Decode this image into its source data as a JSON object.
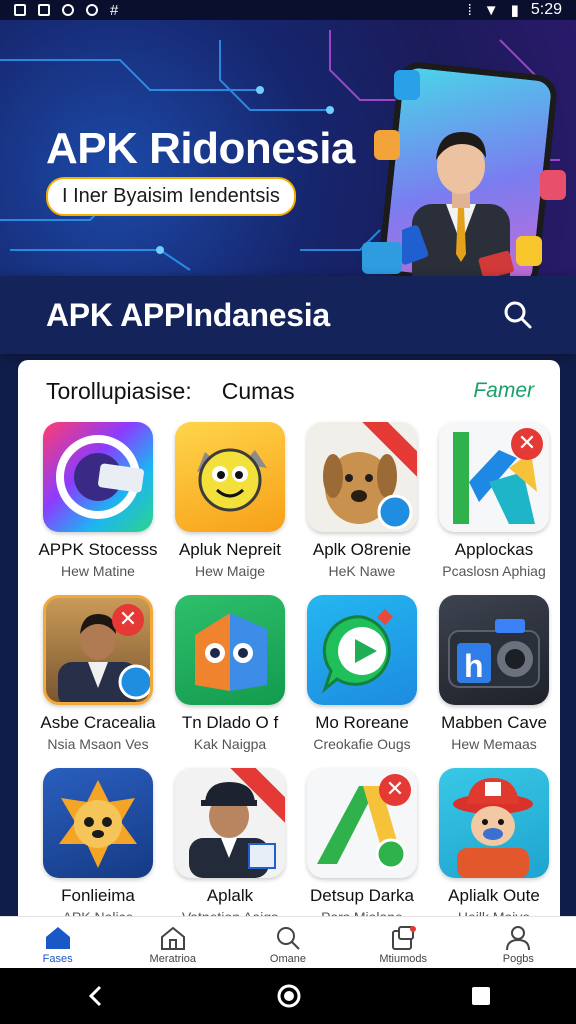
{
  "status": {
    "time": "5:29"
  },
  "banner": {
    "title": "APK Ridonesia",
    "pill": "I Iner Byaisim Iendentsis"
  },
  "appbar": {
    "title": "APK APPIndanesia"
  },
  "section": {
    "title": "Torollupiasise:",
    "tab": "Cumas",
    "action": "Famer"
  },
  "apps": [
    {
      "name": "APPK Stocesss",
      "sub": "Hew Matine",
      "icon": "swirl-app-icon"
    },
    {
      "name": "Apluk Nepreit",
      "sub": "Hew Maige",
      "icon": "yellow-bug-icon"
    },
    {
      "name": "Aplk O8renie",
      "sub": "HeK Nawe",
      "icon": "dog-photo-icon"
    },
    {
      "name": "Applockas",
      "sub": "Pcaslosn Aphiag",
      "icon": "green-blue-k-icon"
    },
    {
      "name": "Asbe Cracealia",
      "sub": "Nsia Msaon Ves",
      "icon": "man-photo-icon"
    },
    {
      "name": "Tn Dlado O f",
      "sub": "Kak Naigpa",
      "icon": "face-split-icon"
    },
    {
      "name": "Mo Roreane",
      "sub": "Creokafie Ougs",
      "icon": "play-chat-icon"
    },
    {
      "name": "Mabben Cave",
      "sub": "Hew Memaas",
      "icon": "camera-icon"
    },
    {
      "name": "Fonlieima",
      "sub": "APK Nalice",
      "icon": "orange-creature-icon"
    },
    {
      "name": "Aplalk",
      "sub": "Vatnetion Aaigs",
      "icon": "capped-man-icon"
    },
    {
      "name": "Detsup Darka",
      "sub": "Pars Mialane",
      "icon": "green-arrow-icon"
    },
    {
      "name": "Aplialk Oute",
      "sub": "Heilk Maive",
      "icon": "fireman-icon"
    }
  ],
  "nav": [
    {
      "label": "Fases",
      "icon": "home-filled-icon"
    },
    {
      "label": "Meratrioa",
      "icon": "home-outline-icon"
    },
    {
      "label": "Omane",
      "icon": "search-icon"
    },
    {
      "label": "Mtiumods",
      "icon": "updates-icon"
    },
    {
      "label": "Pogbs",
      "icon": "person-icon"
    }
  ],
  "colors": {
    "accent": "#1a57c7",
    "appbar": "#14245a",
    "badge": "#e53935",
    "section_action": "#1aa067"
  }
}
